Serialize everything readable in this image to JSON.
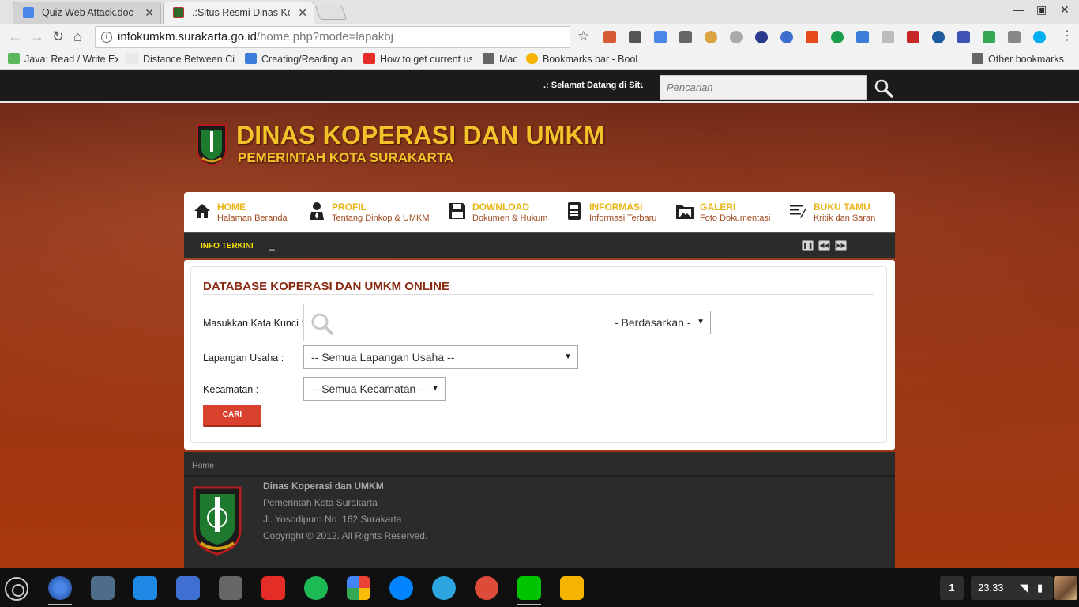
{
  "browser": {
    "tabs": [
      {
        "title": "Quiz Web Attack.doc - Go",
        "active": false
      },
      {
        "title": ".:Situs Resmi Dinas Kope",
        "active": true
      }
    ],
    "url_host": "infokumkm.surakarta.go.id",
    "url_path": "/home.php?mode=lapakbj",
    "bookmarks": [
      {
        "label": "Java: Read / Write Ex",
        "icon": "vp-icon"
      },
      {
        "label": "Distance Between Citi",
        "icon": "dit-icon"
      },
      {
        "label": "Creating/Reading an",
        "icon": "doc-icon"
      },
      {
        "label": "How to get current us",
        "icon": "youtube-icon"
      },
      {
        "label": "Mac",
        "icon": "folder-icon"
      },
      {
        "label": "Bookmarks bar - Book",
        "icon": "star-icon"
      }
    ],
    "other_bookmarks": "Other bookmarks"
  },
  "site": {
    "welcome_text": ".: Selamat Datang di Situs Resmi",
    "search_placeholder": "Pencarian",
    "title": "DINAS KOPERASI DAN UMKM",
    "subtitle": "PEMERINTAH KOTA SURAKARTA",
    "menu": [
      {
        "title": "HOME",
        "subtitle": "Halaman Beranda",
        "icon": "house-icon"
      },
      {
        "title": "PROFIL",
        "subtitle": "Tentang Dinkop & UMKM",
        "icon": "person-icon"
      },
      {
        "title": "DOWNLOAD",
        "subtitle": "Dokumen & Hukum",
        "icon": "floppy-icon"
      },
      {
        "title": "INFORMASI",
        "subtitle": "Informasi Terbaru",
        "icon": "document-icon"
      },
      {
        "title": "GALERI",
        "subtitle": "Foto Dokumentasi",
        "icon": "gallery-icon"
      },
      {
        "title": "BUKU TAMU",
        "subtitle": "Kritik dan Saran",
        "icon": "guestbook-icon"
      }
    ],
    "info_label": "INFO TERKINI",
    "info_text": "_"
  },
  "search_form": {
    "heading": "DATABASE KOPERASI DAN UMKM ONLINE",
    "keyword_label": "Masukkan Kata Kunci :",
    "keyword_value": "",
    "by_select": "- Berdasarkan -",
    "field_label": "Lapangan Usaha :",
    "field_select": "-- Semua Lapangan Usaha --",
    "district_label": "Kecamatan :",
    "district_select": "-- Semua Kecamatan --",
    "submit": "CARI"
  },
  "footer": {
    "breadcrumb": "Home",
    "org": "Dinas Koperasi dan UMKM",
    "gov": "Pemerintah Kota Surakarta",
    "address": "Jl. Yosodipuro No. 162 Surakarta",
    "copyright": "Copyright © 2012. All Rights Reserved."
  },
  "shelf": {
    "notification_count": "1",
    "time": "23:33"
  }
}
